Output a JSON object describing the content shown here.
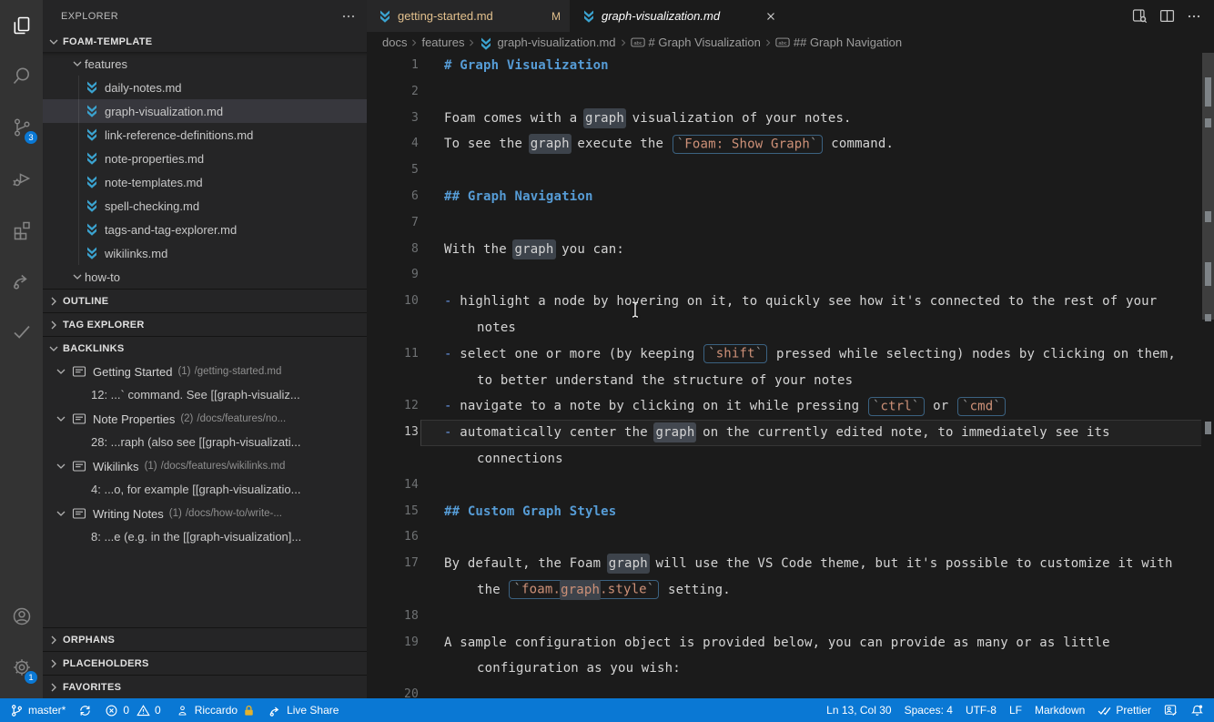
{
  "activity_bar": {
    "items": [
      {
        "id": "explorer",
        "icon": "files",
        "active": true
      },
      {
        "id": "search",
        "icon": "search",
        "active": false
      },
      {
        "id": "source-control",
        "icon": "source-control",
        "badge": "3",
        "active": false
      },
      {
        "id": "run-debug",
        "icon": "debug",
        "active": false
      },
      {
        "id": "extensions",
        "icon": "extensions",
        "active": false
      },
      {
        "id": "live-share",
        "icon": "liveshare",
        "active": false
      },
      {
        "id": "checks",
        "icon": "check",
        "active": false
      }
    ],
    "bottom_items": [
      {
        "id": "account",
        "icon": "account"
      },
      {
        "id": "settings",
        "icon": "gear",
        "badge": "1"
      }
    ]
  },
  "sidebar": {
    "title": "EXPLORER",
    "project": {
      "label": "FOAM-TEMPLATE",
      "expanded": true
    },
    "tree": [
      {
        "label": "features",
        "kind": "folder",
        "expanded": true,
        "selected": false
      },
      {
        "label": "daily-notes.md",
        "kind": "file",
        "selected": false
      },
      {
        "label": "graph-visualization.md",
        "kind": "file",
        "selected": true
      },
      {
        "label": "link-reference-definitions.md",
        "kind": "file",
        "selected": false
      },
      {
        "label": "note-properties.md",
        "kind": "file",
        "selected": false
      },
      {
        "label": "note-templates.md",
        "kind": "file",
        "selected": false
      },
      {
        "label": "spell-checking.md",
        "kind": "file",
        "selected": false
      },
      {
        "label": "tags-and-tag-explorer.md",
        "kind": "file",
        "selected": false
      },
      {
        "label": "wikilinks.md",
        "kind": "file",
        "selected": false
      },
      {
        "label": "how-to",
        "kind": "folder",
        "expanded": true,
        "selected": false
      }
    ],
    "panes_after_tree": [
      {
        "label": "OUTLINE",
        "expanded": false
      },
      {
        "label": "TAG EXPLORER",
        "expanded": false
      }
    ],
    "backlinks": {
      "label": "BACKLINKS",
      "expanded": true,
      "groups": [
        {
          "title": "Getting Started",
          "count": "(1)",
          "path": "/getting-started.md",
          "lines": [
            "12: ...` command. See [[graph-visualiz..."
          ]
        },
        {
          "title": "Note Properties",
          "count": "(2)",
          "path": "/docs/features/no...",
          "lines": [
            "28: ...raph (also see [[graph-visualizati..."
          ]
        },
        {
          "title": "Wikilinks",
          "count": "(1)",
          "path": "/docs/features/wikilinks.md",
          "lines": [
            "4: ...o, for example [[graph-visualizatio..."
          ]
        },
        {
          "title": "Writing Notes",
          "count": "(1)",
          "path": "/docs/how-to/write-...",
          "lines": [
            "8: ...e (e.g. in the [[graph-visualization]..."
          ]
        }
      ]
    },
    "bottom_panes": [
      {
        "label": "ORPHANS",
        "expanded": false
      },
      {
        "label": "PLACEHOLDERS",
        "expanded": false
      },
      {
        "label": "FAVORITES",
        "expanded": false
      }
    ]
  },
  "editor_group": {
    "tabs": [
      {
        "label": "getting-started.md",
        "badge": "M",
        "modified": true,
        "active": false
      },
      {
        "label": "graph-visualization.md",
        "close": "×",
        "active": true,
        "preview": true
      }
    ],
    "breadcrumbs": [
      {
        "label": "docs",
        "icon": null
      },
      {
        "label": "features",
        "icon": null
      },
      {
        "label": "graph-visualization.md",
        "icon": "mdarrow"
      },
      {
        "label": "# Graph Visualization",
        "icon": "abc"
      },
      {
        "label": "## Graph Navigation",
        "icon": "abc"
      }
    ]
  },
  "editor": {
    "lines": [
      {
        "n": "1",
        "parts": [
          [
            "head",
            "# Graph Visualization"
          ]
        ]
      },
      {
        "n": "2",
        "parts": []
      },
      {
        "n": "3",
        "parts": [
          [
            "txt",
            "Foam comes with a "
          ],
          [
            "hl",
            "graph"
          ],
          [
            "txt",
            " visualization of your notes."
          ]
        ]
      },
      {
        "n": "4",
        "parts": [
          [
            "txt",
            "To see the "
          ],
          [
            "hl",
            "graph"
          ],
          [
            "txt",
            " execute the "
          ],
          [
            "code",
            [
              [
                "tick",
                "`"
              ],
              [
                "ct",
                "Foam: Show Graph"
              ],
              [
                "tick",
                "`"
              ]
            ]
          ],
          [
            "txt",
            " command."
          ]
        ]
      },
      {
        "n": "5",
        "parts": []
      },
      {
        "n": "6",
        "parts": [
          [
            "head",
            "## Graph Navigation"
          ]
        ]
      },
      {
        "n": "7",
        "parts": []
      },
      {
        "n": "8",
        "parts": [
          [
            "txt",
            "With the "
          ],
          [
            "hl",
            "graph"
          ],
          [
            "txt",
            " you can:"
          ]
        ]
      },
      {
        "n": "9",
        "parts": []
      },
      {
        "n": "10",
        "parts": [
          [
            "dash",
            "-"
          ],
          [
            "txt",
            " highlight a node by hovering on it, to quickly see how it's connected to the rest of your"
          ]
        ]
      },
      {
        "n": "",
        "cont": true,
        "parts": [
          [
            "txt",
            "notes"
          ]
        ]
      },
      {
        "n": "11",
        "parts": [
          [
            "dash",
            "-"
          ],
          [
            "txt",
            " select one or more (by keeping "
          ],
          [
            "code",
            [
              [
                "tick",
                "`"
              ],
              [
                "ct",
                "shift"
              ],
              [
                "tick",
                "`"
              ]
            ]
          ],
          [
            "txt",
            " pressed while selecting) nodes by clicking on them,"
          ]
        ]
      },
      {
        "n": "",
        "cont": true,
        "parts": [
          [
            "txt",
            "to better understand the structure of your notes"
          ]
        ]
      },
      {
        "n": "12",
        "parts": [
          [
            "dash",
            "-"
          ],
          [
            "txt",
            " navigate to a note by clicking on it while pressing "
          ],
          [
            "code",
            [
              [
                "tick",
                "`"
              ],
              [
                "ct",
                "ctrl"
              ],
              [
                "tick",
                "`"
              ]
            ]
          ],
          [
            "txt",
            " or "
          ],
          [
            "code",
            [
              [
                "tick",
                "`"
              ],
              [
                "ct",
                "cmd"
              ],
              [
                "tick",
                "`"
              ]
            ]
          ]
        ]
      },
      {
        "n": "13",
        "current": true,
        "parts": [
          [
            "dash",
            "-"
          ],
          [
            "txt",
            " automatically center the "
          ],
          [
            "hl",
            "graph"
          ],
          [
            "txt",
            " on the currently edited note, to immediately see its"
          ]
        ]
      },
      {
        "n": "",
        "cont": true,
        "parts": [
          [
            "txt",
            "connections"
          ]
        ]
      },
      {
        "n": "14",
        "parts": []
      },
      {
        "n": "15",
        "parts": [
          [
            "head",
            "## Custom Graph Styles"
          ]
        ]
      },
      {
        "n": "16",
        "parts": []
      },
      {
        "n": "17",
        "parts": [
          [
            "txt",
            "By default, the Foam "
          ],
          [
            "hl",
            "graph"
          ],
          [
            "txt",
            " will use the VS Code theme, but it's possible to customize it with"
          ]
        ]
      },
      {
        "n": "",
        "cont": true,
        "parts": [
          [
            "txt",
            "the "
          ],
          [
            "code",
            [
              [
                "tick",
                "`"
              ],
              [
                "ct",
                "foam."
              ],
              [
                "cthl",
                "graph"
              ],
              [
                "ct",
                ".style"
              ],
              [
                "tick",
                "`"
              ]
            ]
          ],
          [
            "txt",
            " setting."
          ]
        ]
      },
      {
        "n": "18",
        "parts": []
      },
      {
        "n": "19",
        "parts": [
          [
            "txt",
            "A sample configuration object is provided below, you can provide as many or as little"
          ]
        ]
      },
      {
        "n": "",
        "cont": true,
        "parts": [
          [
            "txt",
            "configuration as you wish:"
          ]
        ]
      },
      {
        "n": "20",
        "parts": []
      }
    ]
  },
  "status_bar": {
    "left": [
      {
        "id": "git-branch",
        "icon": "branch",
        "label": "master*"
      },
      {
        "id": "sync",
        "icon": "sync",
        "label": ""
      },
      {
        "id": "problems",
        "parts": [
          {
            "icon": "error",
            "label": "0"
          },
          {
            "icon": "warning",
            "label": "0"
          }
        ]
      },
      {
        "id": "account",
        "icon": "person",
        "label": "Riccardo",
        "lock": true
      },
      {
        "id": "live-share",
        "icon": "liveshare-s",
        "label": "Live Share"
      }
    ],
    "right": [
      {
        "id": "cursor-position",
        "label": "Ln 13, Col 30"
      },
      {
        "id": "indentation",
        "label": "Spaces: 4"
      },
      {
        "id": "encoding",
        "label": "UTF-8"
      },
      {
        "id": "eol",
        "label": "LF"
      },
      {
        "id": "language",
        "label": "Markdown"
      },
      {
        "id": "prettier",
        "icon": "dblcheck",
        "label": "Prettier"
      },
      {
        "id": "feedback",
        "icon": "feedback",
        "label": ""
      },
      {
        "id": "notifications",
        "icon": "bell",
        "label": ""
      }
    ]
  },
  "colors": {
    "status_bar": "#0a78d4",
    "heading": "#569cd6",
    "inline_code": "#ce9178",
    "modified_file": "#e2c08d",
    "file_icon": "#3ba3d0",
    "word_highlight": "#3d434b",
    "selected_row": "#37373d"
  }
}
